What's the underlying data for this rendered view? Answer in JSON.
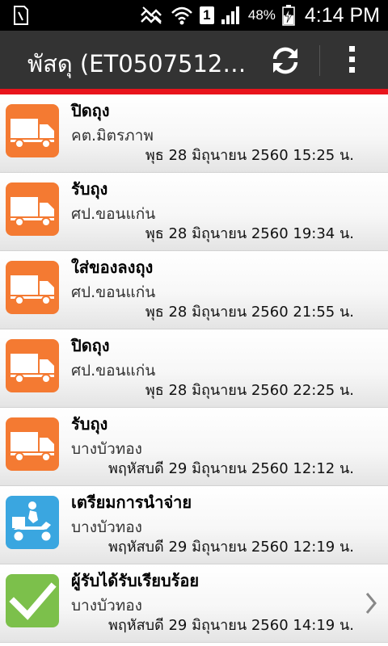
{
  "status_bar": {
    "sim_label": "1",
    "battery_percent": "48%",
    "time": "4:14 PM"
  },
  "app_bar": {
    "title": "พัสดุ  (ET0507512…"
  },
  "colors": {
    "accent_line": "#e8141c",
    "truck_icon_bg": "#f47a32",
    "delivery_icon_bg": "#3aa6e0",
    "done_icon_bg": "#7cc04b"
  },
  "events": [
    {
      "icon": "truck-icon",
      "status": "ปิดถุง",
      "location": "คต.มิตรภาพ",
      "datetime": "พุธ 28 มิถุนายน 2560 15:25 น."
    },
    {
      "icon": "truck-icon",
      "status": "รับถุง",
      "location": "ศป.ขอนแก่น",
      "datetime": "พุธ 28 มิถุนายน 2560 19:34 น."
    },
    {
      "icon": "truck-icon",
      "status": "ใส่ของลงถุง",
      "location": "ศป.ขอนแก่น",
      "datetime": "พุธ 28 มิถุนายน 2560 21:55 น."
    },
    {
      "icon": "truck-icon",
      "status": "ปิดถุง",
      "location": "ศป.ขอนแก่น",
      "datetime": "พุธ 28 มิถุนายน 2560 22:25 น."
    },
    {
      "icon": "truck-icon",
      "status": "รับถุง",
      "location": "บางบัวทอง",
      "datetime": "พฤหัสบดี 29 มิถุนายน 2560 12:12 น."
    },
    {
      "icon": "motorbike-delivery-icon",
      "status": "เตรียมการนำจ่าย",
      "location": "บางบัวทอง",
      "datetime": "พฤหัสบดี 29 มิถุนายน 2560 12:19 น."
    },
    {
      "icon": "checkmark-icon",
      "status": "ผู้รับได้รับเรียบร้อย",
      "location": "บางบัวทอง",
      "datetime": "พฤหัสบดี 29 มิถุนายน 2560 14:19 น."
    }
  ]
}
